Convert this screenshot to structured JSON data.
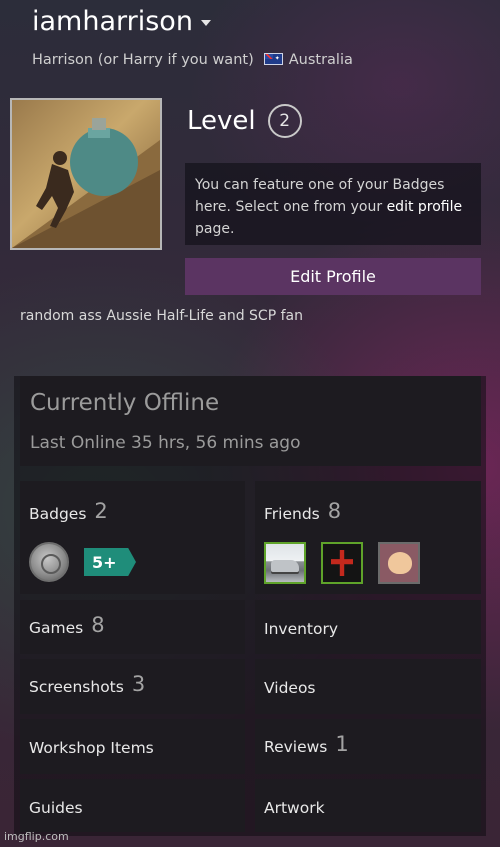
{
  "profile": {
    "username": "iamharrison",
    "real_name": "Harrison (or Harry if you want)",
    "country": "Australia",
    "avatar_icon": "avatar-sisyphus-boulder",
    "level_label": "Level",
    "level": "2",
    "badge_notice_prefix": "You can feature one of your Badges here. Select one from your",
    "badge_notice_link": "edit profile",
    "badge_notice_suffix": "page.",
    "edit_button": "Edit Profile",
    "summary": "random ass Aussie Half-Life and SCP fan"
  },
  "status": {
    "title": "Currently Offline",
    "last_online": "Last Online 35 hrs, 56 mins ago"
  },
  "tiles": {
    "badges": {
      "label": "Badges",
      "count": "2"
    },
    "friends": {
      "label": "Friends",
      "count": "8"
    },
    "games": {
      "label": "Games",
      "count": "8"
    },
    "inventory": {
      "label": "Inventory"
    },
    "screenshots": {
      "label": "Screenshots",
      "count": "3"
    },
    "videos": {
      "label": "Videos"
    },
    "workshop": {
      "label": "Workshop Items"
    },
    "reviews": {
      "label": "Reviews",
      "count": "1"
    },
    "guides": {
      "label": "Guides"
    },
    "artwork": {
      "label": "Artwork"
    }
  },
  "badge_icons": {
    "second": "5+"
  },
  "colors": {
    "edit_button_bg": "#5b3462",
    "tile_bg": "#1d1b20",
    "friend_online_border": "#5fa32a"
  },
  "watermark": "imgflip.com"
}
